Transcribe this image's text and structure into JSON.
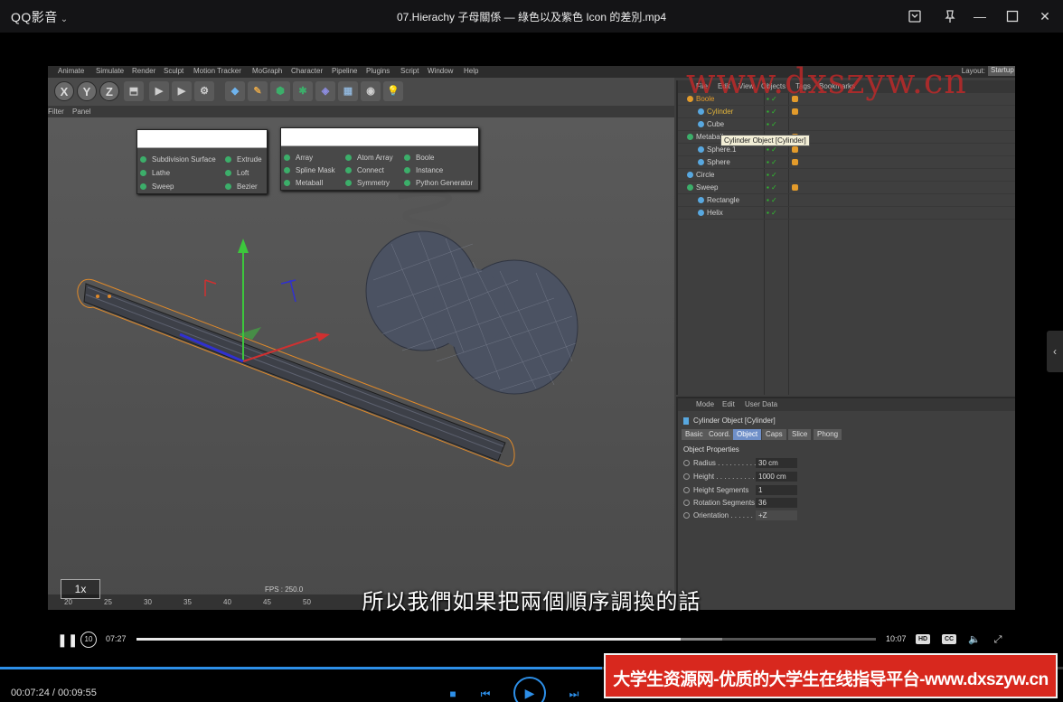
{
  "player": {
    "brand": "QQ影音",
    "title": "07.Hierachy 子母關係 — 綠色以及紫色 Icon 的差別.mp4"
  },
  "c4d": {
    "menu": [
      "Animate",
      "Simulate",
      "Render",
      "Sculpt",
      "Motion Tracker",
      "MoGraph",
      "Character",
      "Pipeline",
      "Plugins",
      "Script",
      "Window",
      "Help"
    ],
    "layout_label": "Layout:",
    "layout_value": "Startup",
    "toolbar_xyz": [
      "X",
      "Y",
      "Z"
    ],
    "viewport_menu": [
      "Filter",
      "Panel"
    ],
    "popup_generators": [
      "Subdivision Surface",
      "Extrude",
      "Lathe",
      "Loft",
      "Sweep",
      "Bezier"
    ],
    "popup_mograph": [
      "Array",
      "Atom Array",
      "Boole",
      "Spline Mask",
      "Connect",
      "Instance",
      "Metaball",
      "Symmetry",
      "Python Generator"
    ],
    "fps": "FPS : 250.0",
    "timeline_ticks": [
      "20",
      "25",
      "30",
      "35",
      "40",
      "45",
      "50"
    ],
    "speed": "1x",
    "object_manager": {
      "menu": [
        "File",
        "Edit",
        "View",
        "Objects",
        "Tags",
        "Bookmarks"
      ],
      "rows": [
        {
          "name": "Boole",
          "indent": 0,
          "color": "#e39b2b",
          "text_color": "#e39b2b"
        },
        {
          "name": "Cylinder",
          "indent": 1,
          "color": "#58a8e0",
          "text_color": "#e3b53b"
        },
        {
          "name": "Cube",
          "indent": 1,
          "color": "#58a8e0",
          "text_color": "#cfcfcf"
        },
        {
          "name": "Metaball",
          "indent": 0,
          "color": "#3cae6a",
          "text_color": "#cfcfcf"
        },
        {
          "name": "Sphere.1",
          "indent": 1,
          "color": "#58a8e0",
          "text_color": "#cfcfcf"
        },
        {
          "name": "Sphere",
          "indent": 1,
          "color": "#58a8e0",
          "text_color": "#cfcfcf"
        },
        {
          "name": "Circle",
          "indent": 0,
          "color": "#58a8e0",
          "text_color": "#cfcfcf"
        },
        {
          "name": "Sweep",
          "indent": 0,
          "color": "#3cae6a",
          "text_color": "#cfcfcf"
        },
        {
          "name": "Rectangle",
          "indent": 1,
          "color": "#58a8e0",
          "text_color": "#cfcfcf"
        },
        {
          "name": "Helix",
          "indent": 1,
          "color": "#58a8e0",
          "text_color": "#cfcfcf"
        }
      ],
      "tooltip": "Cylinder Object [Cylinder]"
    },
    "attribute_manager": {
      "menu": [
        "Mode",
        "Edit",
        "User Data"
      ],
      "object_title": "Cylinder Object [Cylinder]",
      "tabs": [
        "Basic",
        "Coord.",
        "Object",
        "Caps",
        "Slice",
        "Phong"
      ],
      "active_tab": "Object",
      "section": "Object Properties",
      "properties": [
        {
          "label": "Radius . . . . . . . . . .",
          "value": "30 cm"
        },
        {
          "label": "Height . . . . . . . . . .",
          "value": "1000 cm"
        },
        {
          "label": "Height Segments",
          "value": "1"
        },
        {
          "label": "Rotation Segments",
          "value": "36"
        },
        {
          "label": "Orientation . . . . . .",
          "value": "+Z"
        }
      ]
    }
  },
  "watermark": "www.dxszyw.cn",
  "subtitle": "所以我們如果把兩個順序調換的話",
  "controls": {
    "current_time": "07:27",
    "total_time": "10:07",
    "progress": 0.736,
    "buffered": 0.792,
    "hd_badge": "HD",
    "cc_badge": "CC"
  },
  "bottom": {
    "playlist_time": "00:07:24 / 00:09:55",
    "playlist_progress": 0.566
  },
  "ad_banner": "大学生资源网-优质的大学生在线指导平台-www.dxszyw.cn",
  "colors": {
    "accent": "#2d8fe8",
    "ad_background": "#d8281e"
  }
}
